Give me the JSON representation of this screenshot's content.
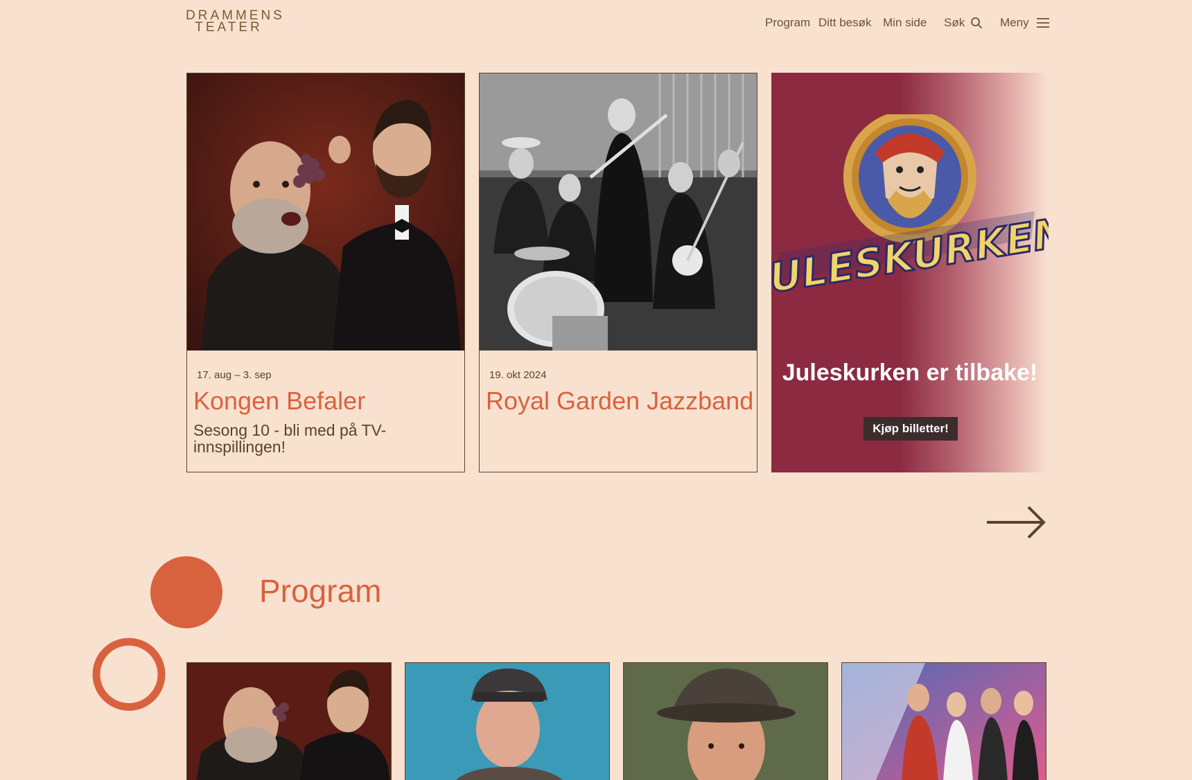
{
  "header": {
    "logo_line1": "DRAMMENS",
    "logo_line2": "TEATER",
    "nav": {
      "program": "Program",
      "ditt_besok": "Ditt besøk",
      "min_side": "Min side",
      "sok": "Søk",
      "meny": "Meny"
    }
  },
  "carousel": {
    "cards": [
      {
        "date": "17. aug – 3. sep",
        "title": "Kongen Befaler",
        "subtitle": "Sesong 10 - bli med på TV-innspillingen!"
      },
      {
        "date": "19. okt 2024",
        "title": "Royal Garden Jazzband",
        "subtitle": ""
      }
    ],
    "promo": {
      "logo_text": "JULESKURKEN",
      "headline": "Juleskurken er tilbake!",
      "cta": "Kjøp billetter!"
    }
  },
  "program": {
    "title": "Program"
  },
  "colors": {
    "background": "#f9e1d0",
    "accent": "#d9623e",
    "text": "#5a4426",
    "promo": "#8c2a42"
  },
  "icons": {
    "search": "search-icon",
    "menu": "hamburger-icon",
    "next": "arrow-right-icon"
  }
}
